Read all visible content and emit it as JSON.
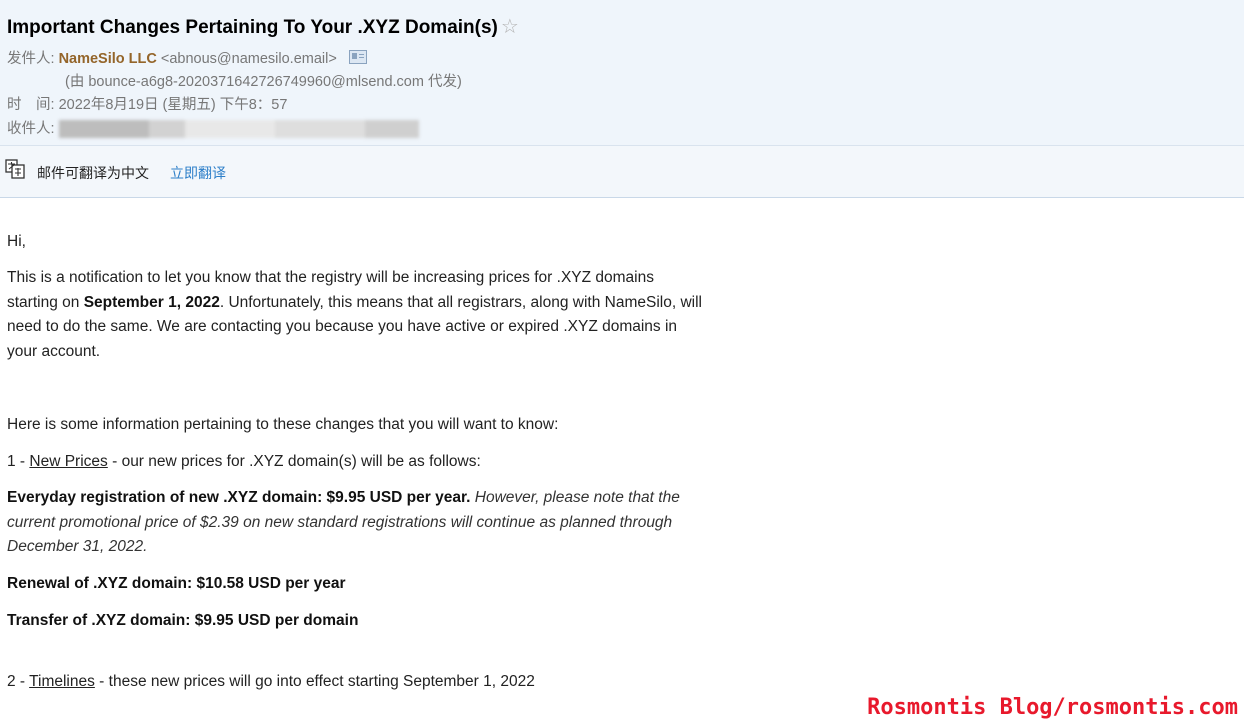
{
  "email": {
    "subject": "Important Changes Pertaining To Your .XYZ Domain(s)",
    "star_icon": "☆",
    "from_label": "发件人:",
    "from_name": "NameSilo LLC",
    "from_email": "<abnous@namesilo.email>",
    "sent_via": "(由 bounce-a6g8-2020371642726749960@mlsend.com 代发)",
    "time_label": "时　间:",
    "time_value": "2022年8月19日 (星期五) 下午8：57",
    "to_label": "收件人:"
  },
  "translate": {
    "prompt": "邮件可翻译为中文",
    "action": "立即翻译"
  },
  "body": {
    "greeting": "Hi,",
    "p1_a": "This is a notification to let you know that the registry will be increasing prices for .XYZ domains starting on ",
    "p1_date": "September 1, 2022",
    "p1_b": ". Unfortunately, this means that all registrars, along with NameSilo, will need to do the same. We are contacting you because you have active or expired .XYZ domains in your account.",
    "p2": "Here is some information pertaining to these changes that you will want to know:",
    "item1_num": "1 - ",
    "item1_link": "New Prices",
    "item1_rest": " - our new prices for .XYZ domain(s) will be as follows:",
    "reg_bold": "Everyday registration of new .XYZ domain: $9.95 USD per year.",
    "reg_italic": " However, please note that the current promotional price of $2.39 on new standard registrations will continue as planned through December 31, 2022.",
    "renewal": "Renewal of .XYZ domain: $10.58 USD per year",
    "transfer": "Transfer of .XYZ domain: $9.95 USD per domain",
    "item2_num": "2 - ",
    "item2_link": "Timelines",
    "item2_rest": " - these new prices will go into effect starting September 1, 2022"
  },
  "watermark": "Rosmontis  Blog/rosmontis.com"
}
